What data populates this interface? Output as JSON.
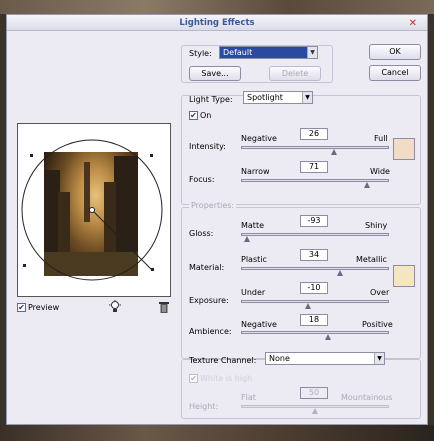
{
  "dialog": {
    "title": "Lighting Effects",
    "close_glyph": "✕"
  },
  "style": {
    "label": "Style:",
    "value": "Default",
    "save_label": "Save...",
    "delete_label": "Delete"
  },
  "buttons": {
    "ok": "OK",
    "cancel": "Cancel"
  },
  "light_type": {
    "label": "Light Type:",
    "value": "Spotlight",
    "on_label": "On",
    "on_checked": true
  },
  "intensity": {
    "label": "Intensity:",
    "min_label": "Negative",
    "max_label": "Full",
    "value": "26",
    "fraction": 0.63
  },
  "focus": {
    "label": "Focus:",
    "min_label": "Narrow",
    "max_label": "Wide",
    "value": "71",
    "fraction": 0.85
  },
  "light_swatch_color": "#f2dcc8",
  "properties": {
    "group_label": "Properties:",
    "gloss": {
      "label": "Gloss:",
      "min_label": "Matte",
      "max_label": "Shiny",
      "value": "-93",
      "fraction": 0.04
    },
    "material": {
      "label": "Material:",
      "min_label": "Plastic",
      "max_label": "Metallic",
      "value": "34",
      "fraction": 0.67
    },
    "exposure": {
      "label": "Exposure:",
      "min_label": "Under",
      "max_label": "Over",
      "value": "-10",
      "fraction": 0.45
    },
    "ambience": {
      "label": "Ambience:",
      "min_label": "Negative",
      "max_label": "Positive",
      "value": "18",
      "fraction": 0.59
    },
    "swatch_color": "#f4e6c0"
  },
  "texture": {
    "label": "Texture Channel:",
    "value": "None",
    "white_high_label": "White is high",
    "height_label": "Height:",
    "height_min": "Flat",
    "height_max": "Mountainous",
    "height_value": "50",
    "height_fraction": 0.5
  },
  "preview": {
    "label": "Preview",
    "checked": true,
    "bulb_icon": "light-bulb-icon",
    "trash_icon": "trash-icon"
  }
}
